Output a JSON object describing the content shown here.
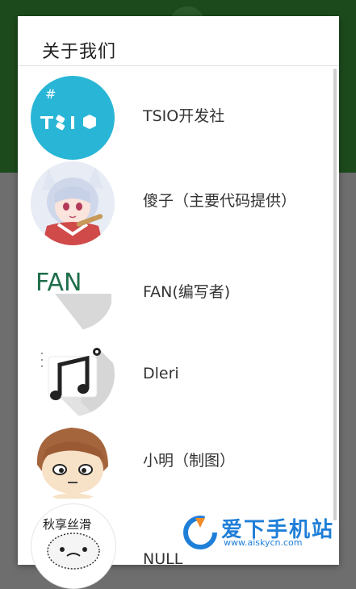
{
  "dialog": {
    "title": "关于我们"
  },
  "members": [
    {
      "name": "TSIO开发社",
      "avatar_text": "TSIO",
      "avatar_hash": "#",
      "avatar_icon": "tsio-logo-icon"
    },
    {
      "name": "傻子（主要代码提供）",
      "avatar_icon": "anime-girl-avatar"
    },
    {
      "name": "FAN(编写者)",
      "avatar_text": "FAN",
      "avatar_icon": "fan-logo-icon"
    },
    {
      "name": "Dleri",
      "avatar_icon": "music-note-icon"
    },
    {
      "name": "小明（制图）",
      "avatar_icon": "chibi-boy-avatar"
    },
    {
      "name": "NULL",
      "avatar_text": "秋享丝滑",
      "avatar_icon": "meme-face-avatar"
    }
  ],
  "watermark": {
    "text": "爱下手机站",
    "url": "www.aiskycn.com"
  },
  "colors": {
    "appbar": "#1d4a1d",
    "tsio_bg": "#29b6d6",
    "fan_green": "#1f6e4a",
    "watermark_blue": "#1f7fd8"
  }
}
